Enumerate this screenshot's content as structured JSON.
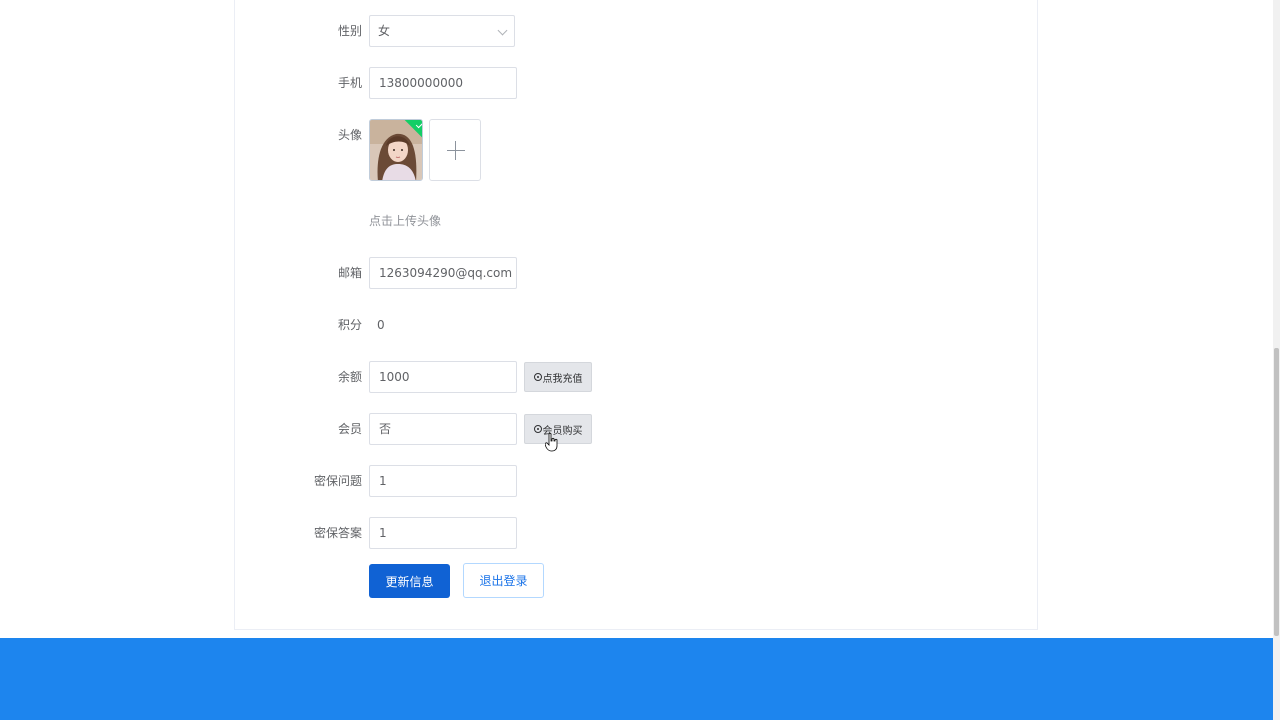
{
  "form": {
    "gender": {
      "label": "性别",
      "value": "女"
    },
    "phone": {
      "label": "手机",
      "value": "13800000000"
    },
    "avatar": {
      "label": "头像",
      "upload_hint": "点击上传头像"
    },
    "email": {
      "label": "邮箱",
      "value": "1263094290@qq.com"
    },
    "points": {
      "label": "积分",
      "value": "0"
    },
    "balance": {
      "label": "余额",
      "value": "1000",
      "button": "点我充值"
    },
    "member": {
      "label": "会员",
      "value": "否",
      "button": "会员购买"
    },
    "security_question": {
      "label": "密保问题",
      "value": "1"
    },
    "security_answer": {
      "label": "密保答案",
      "value": "1"
    }
  },
  "actions": {
    "update": "更新信息",
    "logout": "退出登录"
  },
  "colors": {
    "primary": "#1062d4",
    "footer": "#1d85ee",
    "success": "#13ce66"
  },
  "icons": {
    "select_arrow": "chevron-down-icon",
    "upload": "plus-icon",
    "button_icon": "radio-dot-icon"
  }
}
